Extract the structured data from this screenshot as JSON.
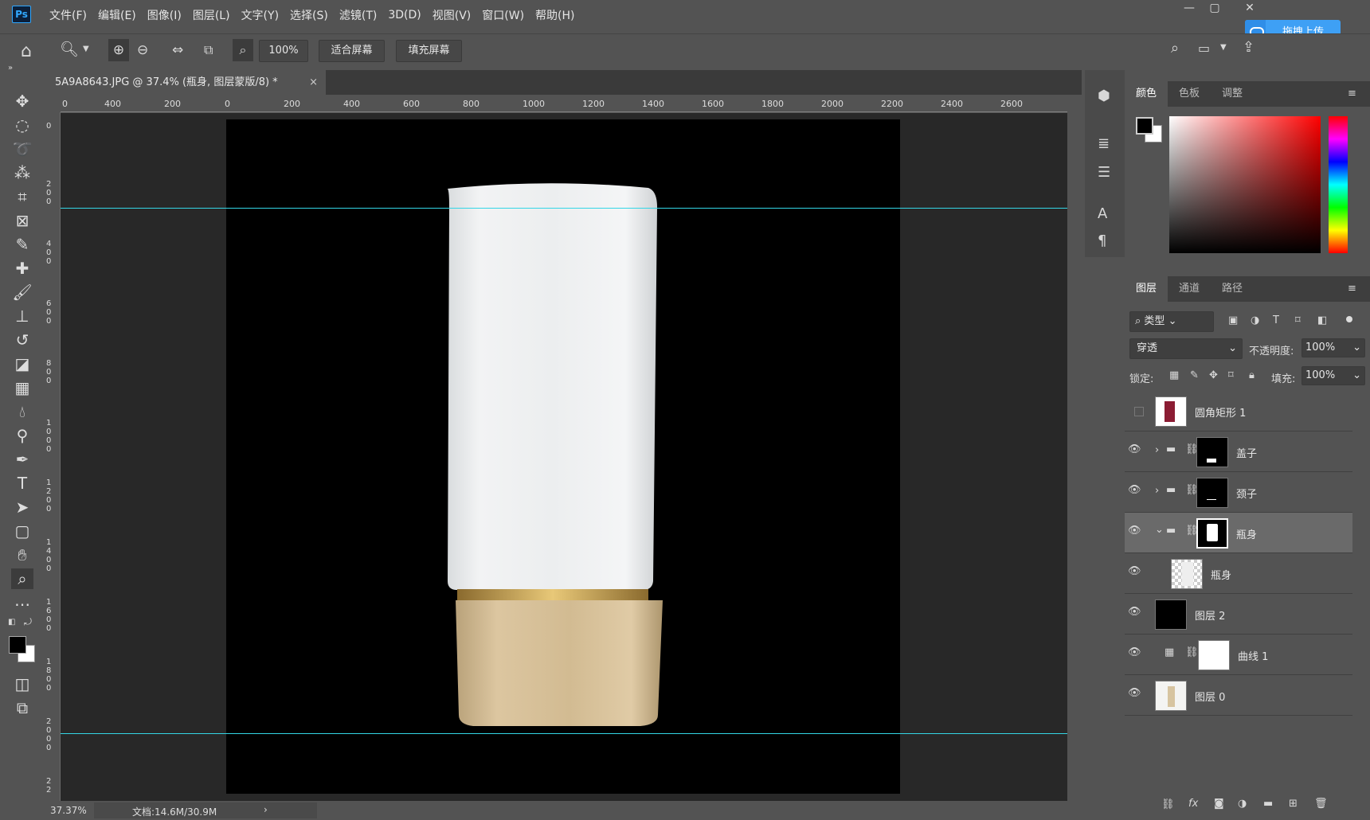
{
  "menu": [
    "文件(F)",
    "编辑(E)",
    "图像(I)",
    "图层(L)",
    "文字(Y)",
    "选择(S)",
    "滤镜(T)",
    "3D(D)",
    "视图(V)",
    "窗口(W)",
    "帮助(H)"
  ],
  "app": {
    "logo": "Ps",
    "upload_label": "拖拽上传"
  },
  "options": {
    "zoom_value": "100%",
    "fit_screen": "适合屏幕",
    "fill_screen": "填充屏幕"
  },
  "document": {
    "tab_title": "5A9A8643.JPG @ 37.4% (瓶身, 图层蒙版/8) *",
    "close": "×"
  },
  "ruler_h": [
    "0",
    "400",
    "200",
    "0",
    "200",
    "400",
    "600",
    "800",
    "1000",
    "1200",
    "1400",
    "1600",
    "1800",
    "2000",
    "2200",
    "2400",
    "2600"
  ],
  "ruler_v": [
    "0",
    "2 0 0",
    "4 0 0",
    "6 0 0",
    "8 0 0",
    "1 0 0 0",
    "1 2 0 0",
    "1 4 0 0",
    "1 6 0 0",
    "1 8 0 0",
    "2 0 0 0",
    "2 2"
  ],
  "status": {
    "zoom": "37.37%",
    "doc_info": "文档:14.6M/30.9M",
    "arrow": "›"
  },
  "color_panel": {
    "tabs": [
      "颜色",
      "色板",
      "调整"
    ]
  },
  "layers_panel": {
    "tabs": [
      "图层",
      "通道",
      "路径"
    ],
    "filter_label": "类型",
    "blend_mode": "穿透",
    "opacity_label": "不透明度:",
    "opacity_value": "100%",
    "lock_label": "锁定:",
    "fill_label": "填充:",
    "fill_value": "100%",
    "layers": [
      {
        "name": "圆角矩形 1",
        "visible": false
      },
      {
        "name": "盖子",
        "visible": true
      },
      {
        "name": "颈子",
        "visible": true
      },
      {
        "name": "瓶身",
        "visible": true,
        "selected": true
      },
      {
        "name": "瓶身",
        "visible": true
      },
      {
        "name": "图层 2",
        "visible": true
      },
      {
        "name": "曲线 1",
        "visible": true
      },
      {
        "name": "图层 0",
        "visible": true
      }
    ]
  },
  "colors": {
    "accent": "#31a8ff",
    "guide": "#33d6e6",
    "cap_gold": "#cdb48a"
  }
}
